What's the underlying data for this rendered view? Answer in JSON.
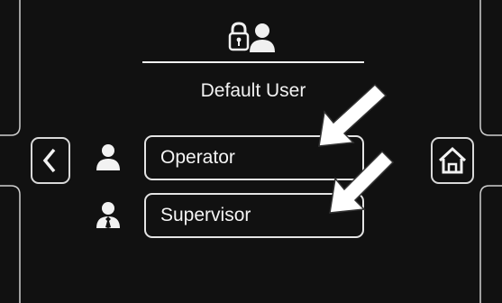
{
  "screen": {
    "current_user": "Default User"
  },
  "nav": {
    "back_icon": "chevron-left-icon",
    "home_icon": "home-icon"
  },
  "header": {
    "icon": "lock-user-icon"
  },
  "roles": [
    {
      "label": "Operator",
      "icon": "user-icon"
    },
    {
      "label": "Supervisor",
      "icon": "user-tie-icon"
    }
  ],
  "colors": {
    "background": "#111111",
    "foreground": "#f2f2f2",
    "outline": "#d8d8d8"
  }
}
